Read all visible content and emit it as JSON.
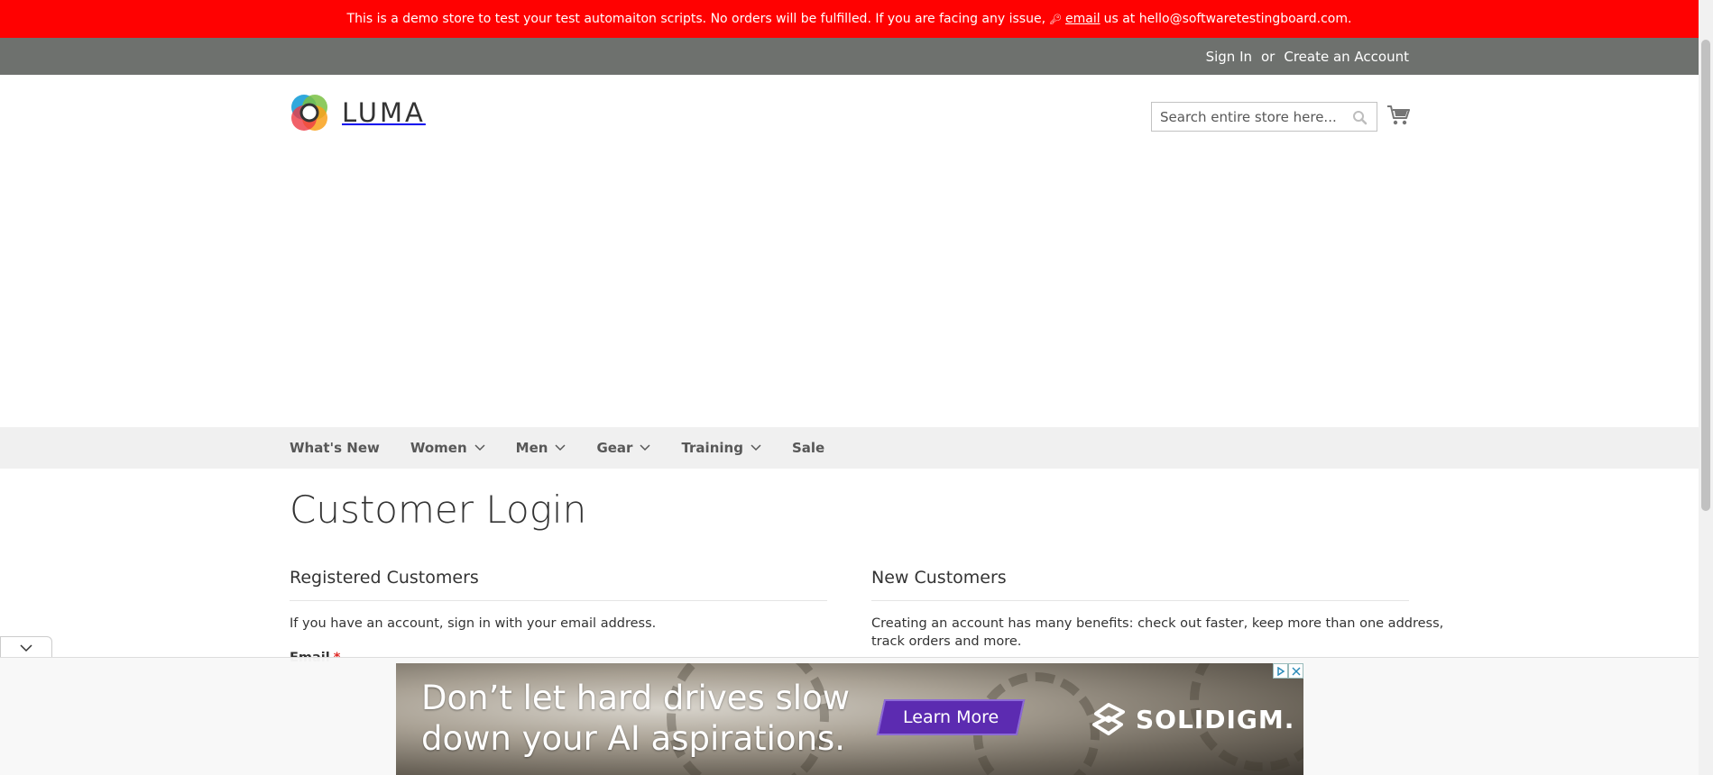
{
  "banner": {
    "text_before": "This is a demo store to test your test automaiton scripts. No orders will be fulfilled. If you are facing any issue,",
    "email_link": "email",
    "text_after": "us at hello@softwaretestingboard.com."
  },
  "header": {
    "sign_in": "Sign In",
    "or": "or",
    "create_account": "Create an Account"
  },
  "logo": {
    "text": "LUMA"
  },
  "search": {
    "placeholder": "Search entire store here..."
  },
  "nav": {
    "items": [
      {
        "label": "What's New",
        "has_submenu": false
      },
      {
        "label": "Women",
        "has_submenu": true
      },
      {
        "label": "Men",
        "has_submenu": true
      },
      {
        "label": "Gear",
        "has_submenu": true
      },
      {
        "label": "Training",
        "has_submenu": true
      },
      {
        "label": "Sale",
        "has_submenu": false
      }
    ]
  },
  "main": {
    "title": "Customer Login",
    "registered": {
      "title": "Registered Customers",
      "text": "If you have an account, sign in with your email address.",
      "email_label": "Email",
      "required_mark": "*"
    },
    "new_customers": {
      "title": "New Customers",
      "text_line1": "Creating an account has many benefits: check out faster, keep more than one address,",
      "text_line2": "track orders and more."
    }
  },
  "ad": {
    "headline_line1": "Don’t let hard drives slow",
    "headline_line2": "down your AI aspirations.",
    "cta": "Learn More",
    "brand": "SOLIDIGM."
  },
  "colors": {
    "banner_bg": "#ff0101",
    "header_panel_bg": "#6e716e",
    "nav_bg": "#f0f0f0",
    "ad_cta_bg": "#5c2bb1"
  }
}
